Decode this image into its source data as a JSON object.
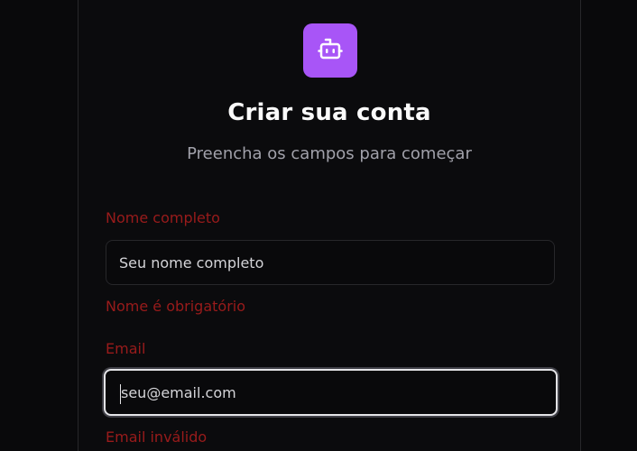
{
  "header": {
    "logo_icon": "bot-icon",
    "title": "Criar sua conta",
    "subtitle": "Preencha os campos para começar"
  },
  "form": {
    "name": {
      "label": "Nome completo",
      "placeholder": "Seu nome completo",
      "value": "",
      "error": "Nome é obrigatório"
    },
    "email": {
      "label": "Email",
      "placeholder": "seu@email.com",
      "value": "",
      "error": "Email inválido"
    }
  },
  "colors": {
    "accent": "#a855f7",
    "error": "#991b1b",
    "background": "#09090b"
  }
}
